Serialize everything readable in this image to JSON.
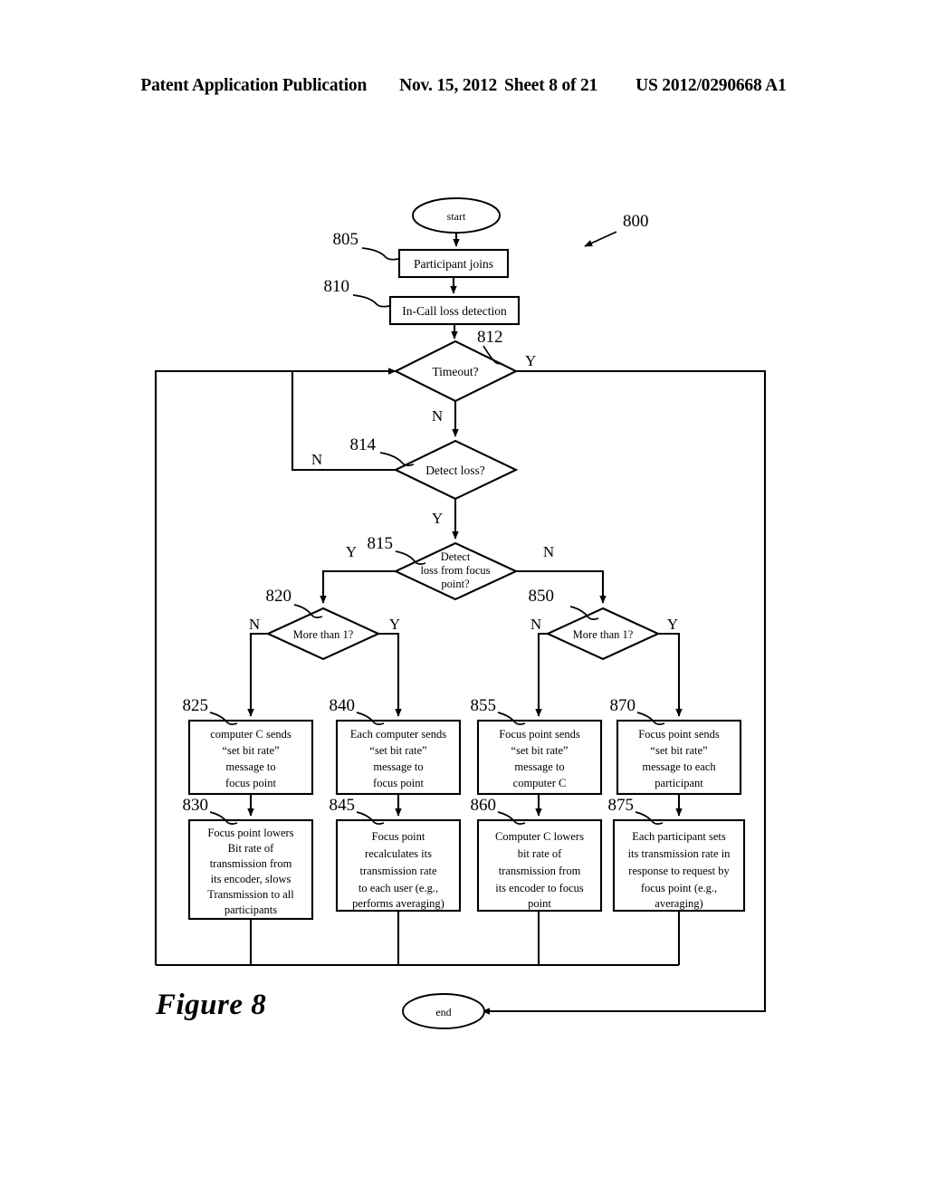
{
  "header": {
    "publication": "Patent Application Publication",
    "date": "Nov. 15, 2012",
    "sheet": "Sheet 8 of 21",
    "number": "US 2012/0290668 A1"
  },
  "figure": {
    "caption": "Figure 8",
    "diagram_ref": "800",
    "terminators": {
      "start": "start",
      "end": "end"
    },
    "nodes": [
      {
        "ref": "805",
        "type": "process",
        "lines": [
          "Participant joins"
        ]
      },
      {
        "ref": "810",
        "type": "process",
        "lines": [
          "In-Call loss detection"
        ]
      },
      {
        "ref": "812",
        "type": "decision",
        "lines": [
          "Timeout?"
        ]
      },
      {
        "ref": "814",
        "type": "decision",
        "lines": [
          "Detect loss?"
        ]
      },
      {
        "ref": "815",
        "type": "decision",
        "lines": [
          "Detect",
          "loss from focus",
          "point?"
        ]
      },
      {
        "ref": "820",
        "type": "decision",
        "lines": [
          "More than 1?"
        ]
      },
      {
        "ref": "850",
        "type": "decision",
        "lines": [
          "More than 1?"
        ]
      },
      {
        "ref": "825",
        "type": "process",
        "lines": [
          "computer C sends",
          "“set bit rate”",
          "message to",
          "focus point"
        ]
      },
      {
        "ref": "840",
        "type": "process",
        "lines": [
          "Each computer sends",
          "“set bit rate”",
          "message to",
          "focus point"
        ]
      },
      {
        "ref": "855",
        "type": "process",
        "lines": [
          "Focus point sends",
          "“set bit rate”",
          "message to",
          "computer C"
        ]
      },
      {
        "ref": "870",
        "type": "process",
        "lines": [
          "Focus point sends",
          "“set bit rate”",
          "message to each",
          "participant"
        ]
      },
      {
        "ref": "830",
        "type": "process",
        "lines": [
          "Focus point lowers",
          "Bit rate of",
          "transmission from",
          "its encoder, slows",
          "Transmission to all",
          "participants"
        ]
      },
      {
        "ref": "845",
        "type": "process",
        "lines": [
          "Focus point",
          "recalculates its",
          "transmission rate",
          "to each user (e.g.,",
          "performs averaging)"
        ]
      },
      {
        "ref": "860",
        "type": "process",
        "lines": [
          "Computer C lowers",
          "bit rate of",
          "transmission from",
          "its encoder to focus",
          "point"
        ]
      },
      {
        "ref": "875",
        "type": "process",
        "lines": [
          "Each participant sets",
          "its transmission rate in",
          "response to request by",
          "focus point (e.g.,",
          "averaging)"
        ]
      }
    ],
    "branch_labels": {
      "timeout_yes": "Y",
      "timeout_no": "N",
      "detect_loss_no": "N",
      "detect_loss_yes": "Y",
      "focus_yes": "Y",
      "focus_no": "N",
      "more820_no": "N",
      "more820_yes": "Y",
      "more850_no": "N",
      "more850_yes": "Y"
    }
  }
}
